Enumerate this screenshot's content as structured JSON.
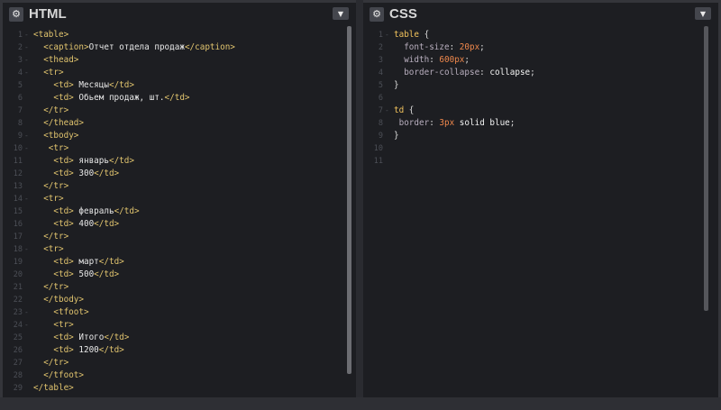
{
  "html_pane": {
    "title": "HTML",
    "settings_icon": "gear-icon",
    "collapse_icon": "chevron-down-icon",
    "lines": [
      {
        "n": "1",
        "fold": "-",
        "text": "<table>"
      },
      {
        "n": "2",
        "fold": "-",
        "text": "  <caption>Отчет отдела продаж</caption>"
      },
      {
        "n": "3",
        "fold": "-",
        "text": "  <thead>"
      },
      {
        "n": "4",
        "fold": "-",
        "text": "  <tr>"
      },
      {
        "n": "5",
        "fold": "",
        "text": "    <td> Месяцы</td>"
      },
      {
        "n": "6",
        "fold": "",
        "text": "    <td> Обьем продаж, шт.</td>"
      },
      {
        "n": "7",
        "fold": "",
        "text": "  </tr>"
      },
      {
        "n": "8",
        "fold": "",
        "text": "  </thead>"
      },
      {
        "n": "9",
        "fold": "-",
        "text": "  <tbody>"
      },
      {
        "n": "10",
        "fold": "-",
        "text": "   <tr>"
      },
      {
        "n": "11",
        "fold": "",
        "text": "    <td> январь</td>"
      },
      {
        "n": "12",
        "fold": "",
        "text": "    <td> 300</td>"
      },
      {
        "n": "13",
        "fold": "",
        "text": "  </tr>"
      },
      {
        "n": "14",
        "fold": "-",
        "text": "  <tr>"
      },
      {
        "n": "15",
        "fold": "",
        "text": "    <td> февраль</td>"
      },
      {
        "n": "16",
        "fold": "",
        "text": "    <td> 400</td>"
      },
      {
        "n": "17",
        "fold": "",
        "text": "  </tr>"
      },
      {
        "n": "18",
        "fold": "-",
        "text": "  <tr>"
      },
      {
        "n": "19",
        "fold": "",
        "text": "    <td> март</td>"
      },
      {
        "n": "20",
        "fold": "",
        "text": "    <td> 500</td>"
      },
      {
        "n": "21",
        "fold": "",
        "text": "  </tr>"
      },
      {
        "n": "22",
        "fold": "",
        "text": "  </tbody>"
      },
      {
        "n": "23",
        "fold": "-",
        "text": "    <tfoot>"
      },
      {
        "n": "24",
        "fold": "-",
        "text": "    <tr>"
      },
      {
        "n": "25",
        "fold": "",
        "text": "    <td> Итого</td>"
      },
      {
        "n": "26",
        "fold": "",
        "text": "    <td> 1200</td>"
      },
      {
        "n": "27",
        "fold": "",
        "text": "  </tr>"
      },
      {
        "n": "28",
        "fold": "",
        "text": "  </tfoot>"
      },
      {
        "n": "29",
        "fold": "",
        "text": "</table>"
      }
    ]
  },
  "css_pane": {
    "title": "CSS",
    "settings_icon": "gear-icon",
    "collapse_icon": "chevron-down-icon",
    "lines": [
      {
        "n": "1",
        "fold": "-",
        "text": "table {"
      },
      {
        "n": "2",
        "fold": "",
        "text": "  font-size: 20px;"
      },
      {
        "n": "3",
        "fold": "",
        "text": "  width: 600px;"
      },
      {
        "n": "4",
        "fold": "",
        "text": "  border-collapse: collapse;"
      },
      {
        "n": "5",
        "fold": "",
        "text": "}"
      },
      {
        "n": "6",
        "fold": "",
        "text": ""
      },
      {
        "n": "7",
        "fold": "-",
        "text": "td {"
      },
      {
        "n": "8",
        "fold": "",
        "text": " border: 3px solid blue;"
      },
      {
        "n": "9",
        "fold": "",
        "text": "}"
      },
      {
        "n": "10",
        "fold": "",
        "text": ""
      },
      {
        "n": "11",
        "fold": "",
        "text": ""
      }
    ]
  }
}
